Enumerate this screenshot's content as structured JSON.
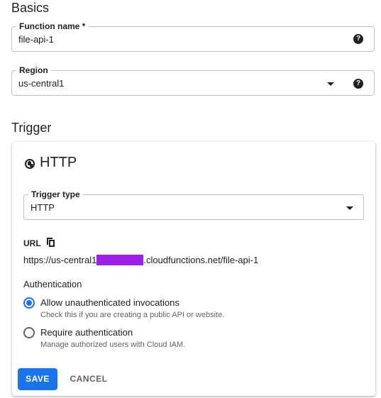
{
  "basics": {
    "title": "Basics",
    "function_name": {
      "label": "Function name *",
      "value": "file-api-1",
      "help_icon": "help-circle-icon"
    },
    "region": {
      "label": "Region",
      "value": "us-central1",
      "dropdown_icon": "arrow-drop-down-icon",
      "help_icon": "help-circle-icon"
    }
  },
  "trigger": {
    "title": "Trigger",
    "card": {
      "title": "HTTP",
      "title_icon": "globe-icon",
      "trigger_type": {
        "label": "Trigger type",
        "value": "HTTP",
        "dropdown_icon": "arrow-drop-down-icon"
      },
      "url": {
        "label": "URL",
        "copy_icon": "copy-icon",
        "prefix": "https://us-central1",
        "suffix": ".cloudfunctions.net/file-api-1"
      },
      "authentication": {
        "label": "Authentication",
        "options": [
          {
            "label": "Allow unauthenticated invocations",
            "help": "Check this if you are creating a public API or website.",
            "checked": true
          },
          {
            "label": "Require authentication",
            "help": "Manage authorized users with Cloud IAM.",
            "checked": false
          }
        ]
      },
      "save_label": "SAVE",
      "cancel_label": "CANCEL"
    }
  },
  "colors": {
    "primary": "#1a73e8",
    "redaction": "#9d1fe8",
    "text": "#202124",
    "secondary_text": "#5f6368"
  }
}
